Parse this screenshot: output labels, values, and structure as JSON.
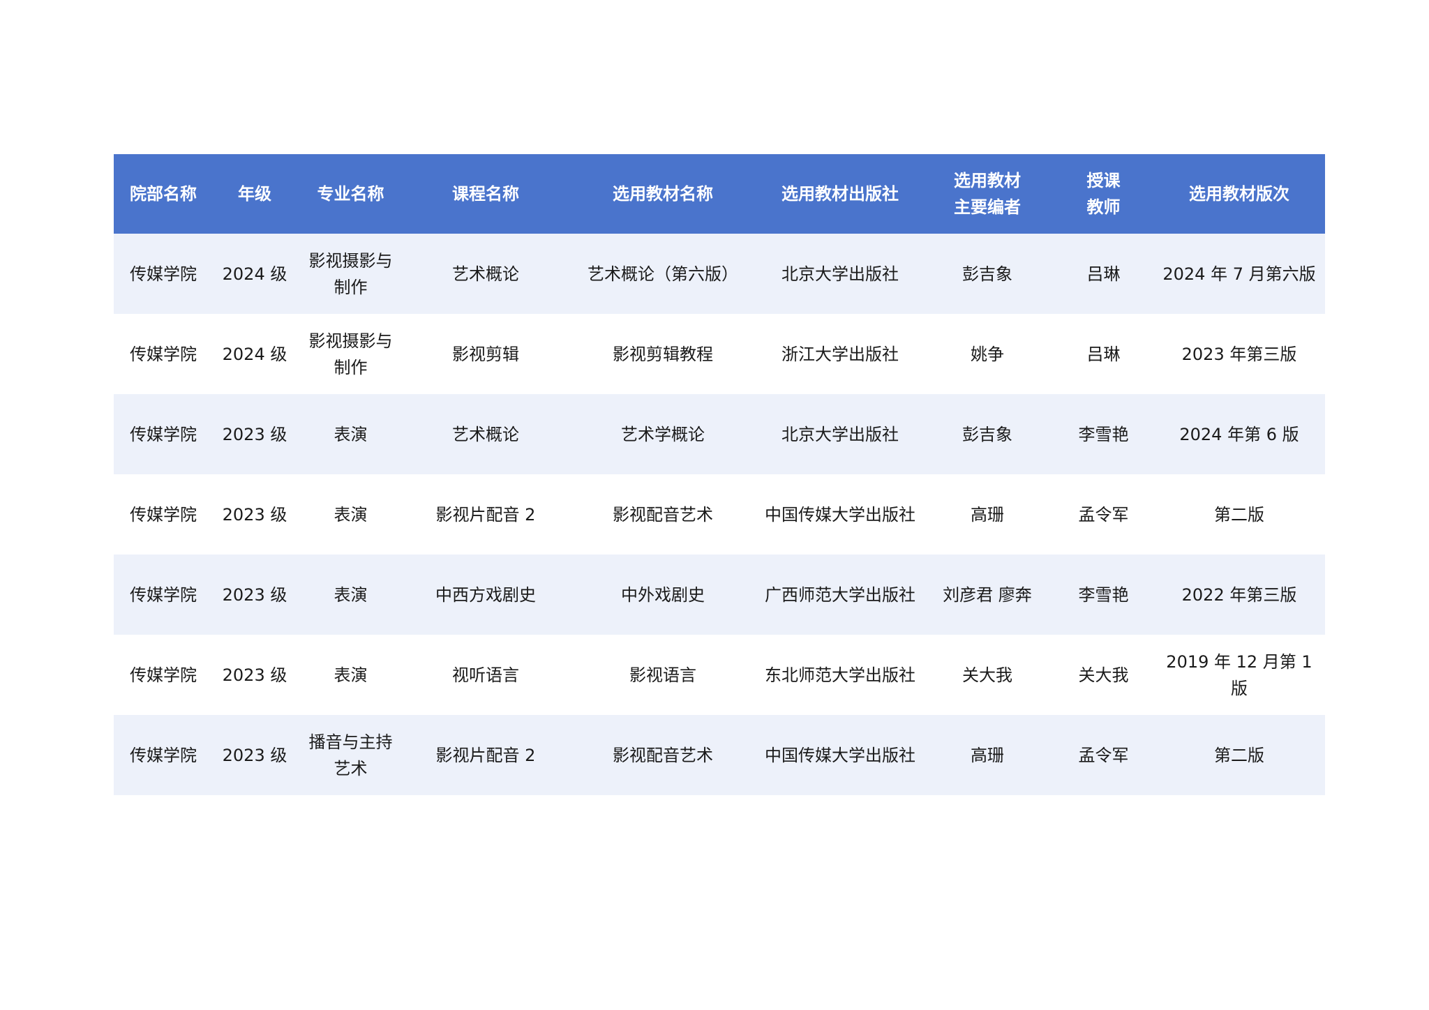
{
  "table": {
    "headers": [
      "院部名称",
      "年级",
      "专业名称",
      "课程名称",
      "选用教材名称",
      "选用教材出版社",
      "选用教材\n主要编者",
      "授课\n教师",
      "选用教材版次"
    ],
    "rows": [
      [
        "传媒学院",
        "2024 级",
        "影视摄影与制作",
        "艺术概论",
        "艺术概论（第六版）",
        "北京大学出版社",
        "彭吉象",
        "吕琳",
        "2024 年 7 月第六版"
      ],
      [
        "传媒学院",
        "2024 级",
        "影视摄影与制作",
        "影视剪辑",
        "影视剪辑教程",
        "浙江大学出版社",
        "姚争",
        "吕琳",
        "2023 年第三版"
      ],
      [
        "传媒学院",
        "2023 级",
        "表演",
        "艺术概论",
        "艺术学概论",
        "北京大学出版社",
        "彭吉象",
        "李雪艳",
        "2024 年第 6 版"
      ],
      [
        "传媒学院",
        "2023 级",
        "表演",
        "影视片配音 2",
        "影视配音艺术",
        "中国传媒大学出版社",
        "高珊",
        "孟令军",
        "第二版"
      ],
      [
        "传媒学院",
        "2023 级",
        "表演",
        "中西方戏剧史",
        "中外戏剧史",
        "广西师范大学出版社",
        "刘彦君 廖奔",
        "李雪艳",
        "2022 年第三版"
      ],
      [
        "传媒学院",
        "2023 级",
        "表演",
        "视听语言",
        "影视语言",
        "东北师范大学出版社",
        "关大我",
        "关大我",
        "2019 年 12 月第 1 版"
      ],
      [
        "传媒学院",
        "2023 级",
        "播音与主持艺术",
        "影视片配音 2",
        "影视配音艺术",
        "中国传媒大学出版社",
        "高珊",
        "孟令军",
        "第二版"
      ]
    ]
  }
}
